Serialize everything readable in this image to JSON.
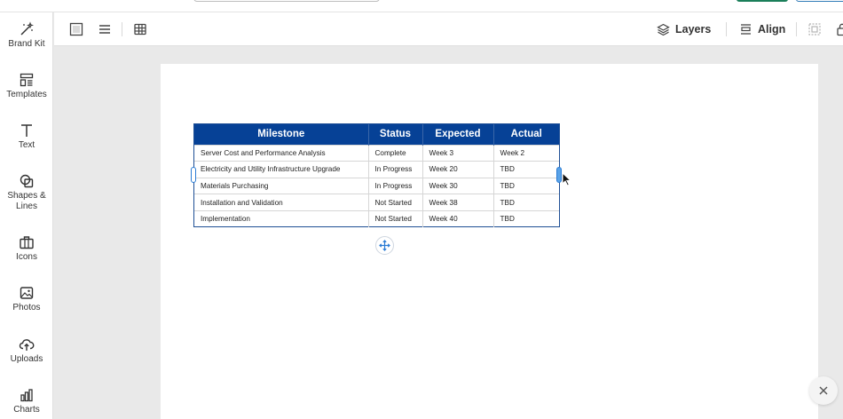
{
  "sidebar": {
    "items": [
      {
        "label": "Brand Kit",
        "icon": "magic-wand-icon"
      },
      {
        "label": "Templates",
        "icon": "templates-icon"
      },
      {
        "label": "Text",
        "icon": "text-icon"
      },
      {
        "label": "Shapes & Lines",
        "icon": "shapes-icon"
      },
      {
        "label": "Icons",
        "icon": "briefcase-icon"
      },
      {
        "label": "Photos",
        "icon": "photo-icon"
      },
      {
        "label": "Uploads",
        "icon": "cloud-upload-icon"
      },
      {
        "label": "Charts",
        "icon": "bar-chart-icon"
      }
    ]
  },
  "toolbar": {
    "layers_label": "Layers",
    "align_label": "Align"
  },
  "table": {
    "headers": [
      "Milestone",
      "Status",
      "Expected",
      "Actual"
    ],
    "header_color": "#064196",
    "rows": [
      [
        "Server Cost and Performance Analysis",
        "Complete",
        "Week 3",
        "Week 2"
      ],
      [
        "Electricity and Utility Infrastructure Upgrade",
        "In Progress",
        "Week 20",
        "TBD"
      ],
      [
        "Materials Purchasing",
        "In Progress",
        "Week 30",
        "TBD"
      ],
      [
        "Installation and Validation",
        "Not Started",
        "Week 38",
        "TBD"
      ],
      [
        "Implementation",
        "Not Started",
        "Week 40",
        "TBD"
      ]
    ]
  },
  "colors": {
    "accent_blue": "#2a7bd4",
    "primary_green": "#1b7f5a"
  }
}
